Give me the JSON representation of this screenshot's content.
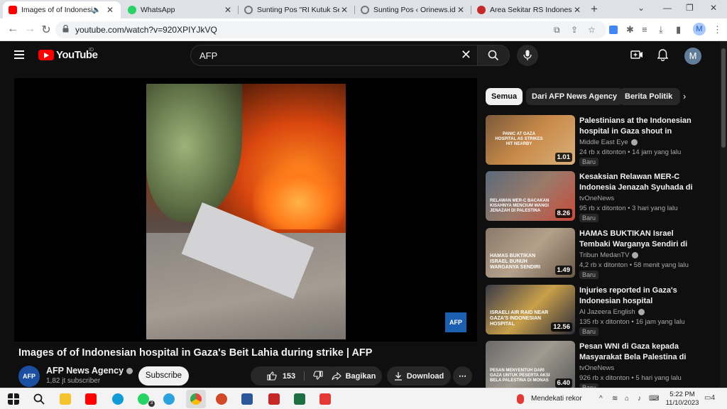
{
  "browser": {
    "tabs": [
      {
        "title": "Images of of Indonesia",
        "color": "#ff0000"
      },
      {
        "title": "WhatsApp",
        "color": "#25d366"
      },
      {
        "title": "Sunting Pos \"RI Kutuk Seran",
        "color": "#777777"
      },
      {
        "title": "Sunting Pos ‹ Orinews.id —",
        "color": "#777777"
      },
      {
        "title": "Area Sekitar RS Indonesia di",
        "color": "#c62828"
      }
    ],
    "url": "youtube.com/watch?v=920XPIYJkVQ",
    "profile_initial": "M"
  },
  "youtube": {
    "logo_text": "YouTube",
    "country_code": "ID",
    "search_query": "AFP",
    "avatar_initial": "M"
  },
  "video": {
    "title": "Images of of Indonesian hospital in Gaza's Beit Lahia during strike | AFP",
    "watermark": "AFP",
    "channel": {
      "name": "AFP News Agency",
      "avatar_text": "AFP",
      "subscribers": "1,82 jt subscriber"
    },
    "subscribe_label": "Subscribe",
    "likes": "153",
    "share_label": "Bagikan",
    "download_label": "Download",
    "more_label": "⋯"
  },
  "chips": [
    "Semua",
    "Dari AFP News Agency",
    "Berita Politik"
  ],
  "recommendations": [
    {
      "title": "Palestinians at the Indonesian hospital in Gaza shout in panic as Israeli...",
      "channel": "Middle East Eye",
      "views": "24 rb x ditonton",
      "age": "14 jam yang lalu",
      "duration": "1.01",
      "badge": "Baru",
      "thumb_caption": "PANIC AT GAZA HOSPITAL AS STRIKES HIT NEARBY"
    },
    {
      "title": "Kesaksian Relawan MER-C Indonesia Jenazah Syuhada di Gaza...",
      "channel": "tvOneNews",
      "views": "95 rb x ditonton",
      "age": "3 hari yang lalu",
      "duration": "8.26",
      "badge": "Baru",
      "thumb_caption": "RELAWAN MER-C BACAKAN KISAHNYA MENCIUM WANGI JENAZAH DI PALESTINA"
    },
    {
      "title": "HAMAS BUKTIKAN Israel Tembaki Warganya Sendiri di Festival...",
      "channel": "Tribun MedanTV",
      "views": "4,2 rb x ditonton",
      "age": "58 menit yang lalu",
      "duration": "1.49",
      "badge": "Baru",
      "thumb_caption": "HAMAS BUKTIKAN ISRAEL BUNUH WARGANYA SENDIRI"
    },
    {
      "title": "Injuries reported in Gaza's Indonesian hospital",
      "channel": "Al Jazeera English",
      "views": "135 rb x ditonton",
      "age": "16 jam yang lalu",
      "duration": "12.56",
      "badge": "Baru",
      "thumb_caption": "ISRAELI AIR RAID NEAR GAZA'S INDONESIAN HOSPITAL"
    },
    {
      "title": "Pesan WNI di Gaza kepada Masyarakat Bela Palestina di Monas...",
      "channel": "tvOneNews",
      "views": "926 rb x ditonton",
      "age": "5 hari yang lalu",
      "duration": "6.40",
      "badge": "Baru",
      "thumb_caption": "PESAN MENYENTUH DARI GAZA UNTUK PESERTA AKSI BELA PALESTINA DI MONAS"
    }
  ],
  "taskbar": {
    "weather": "Mendekati rekor",
    "time": "5:22 PM",
    "date": "11/10/2023",
    "notifications": "4",
    "whatsapp_badge": "3"
  }
}
